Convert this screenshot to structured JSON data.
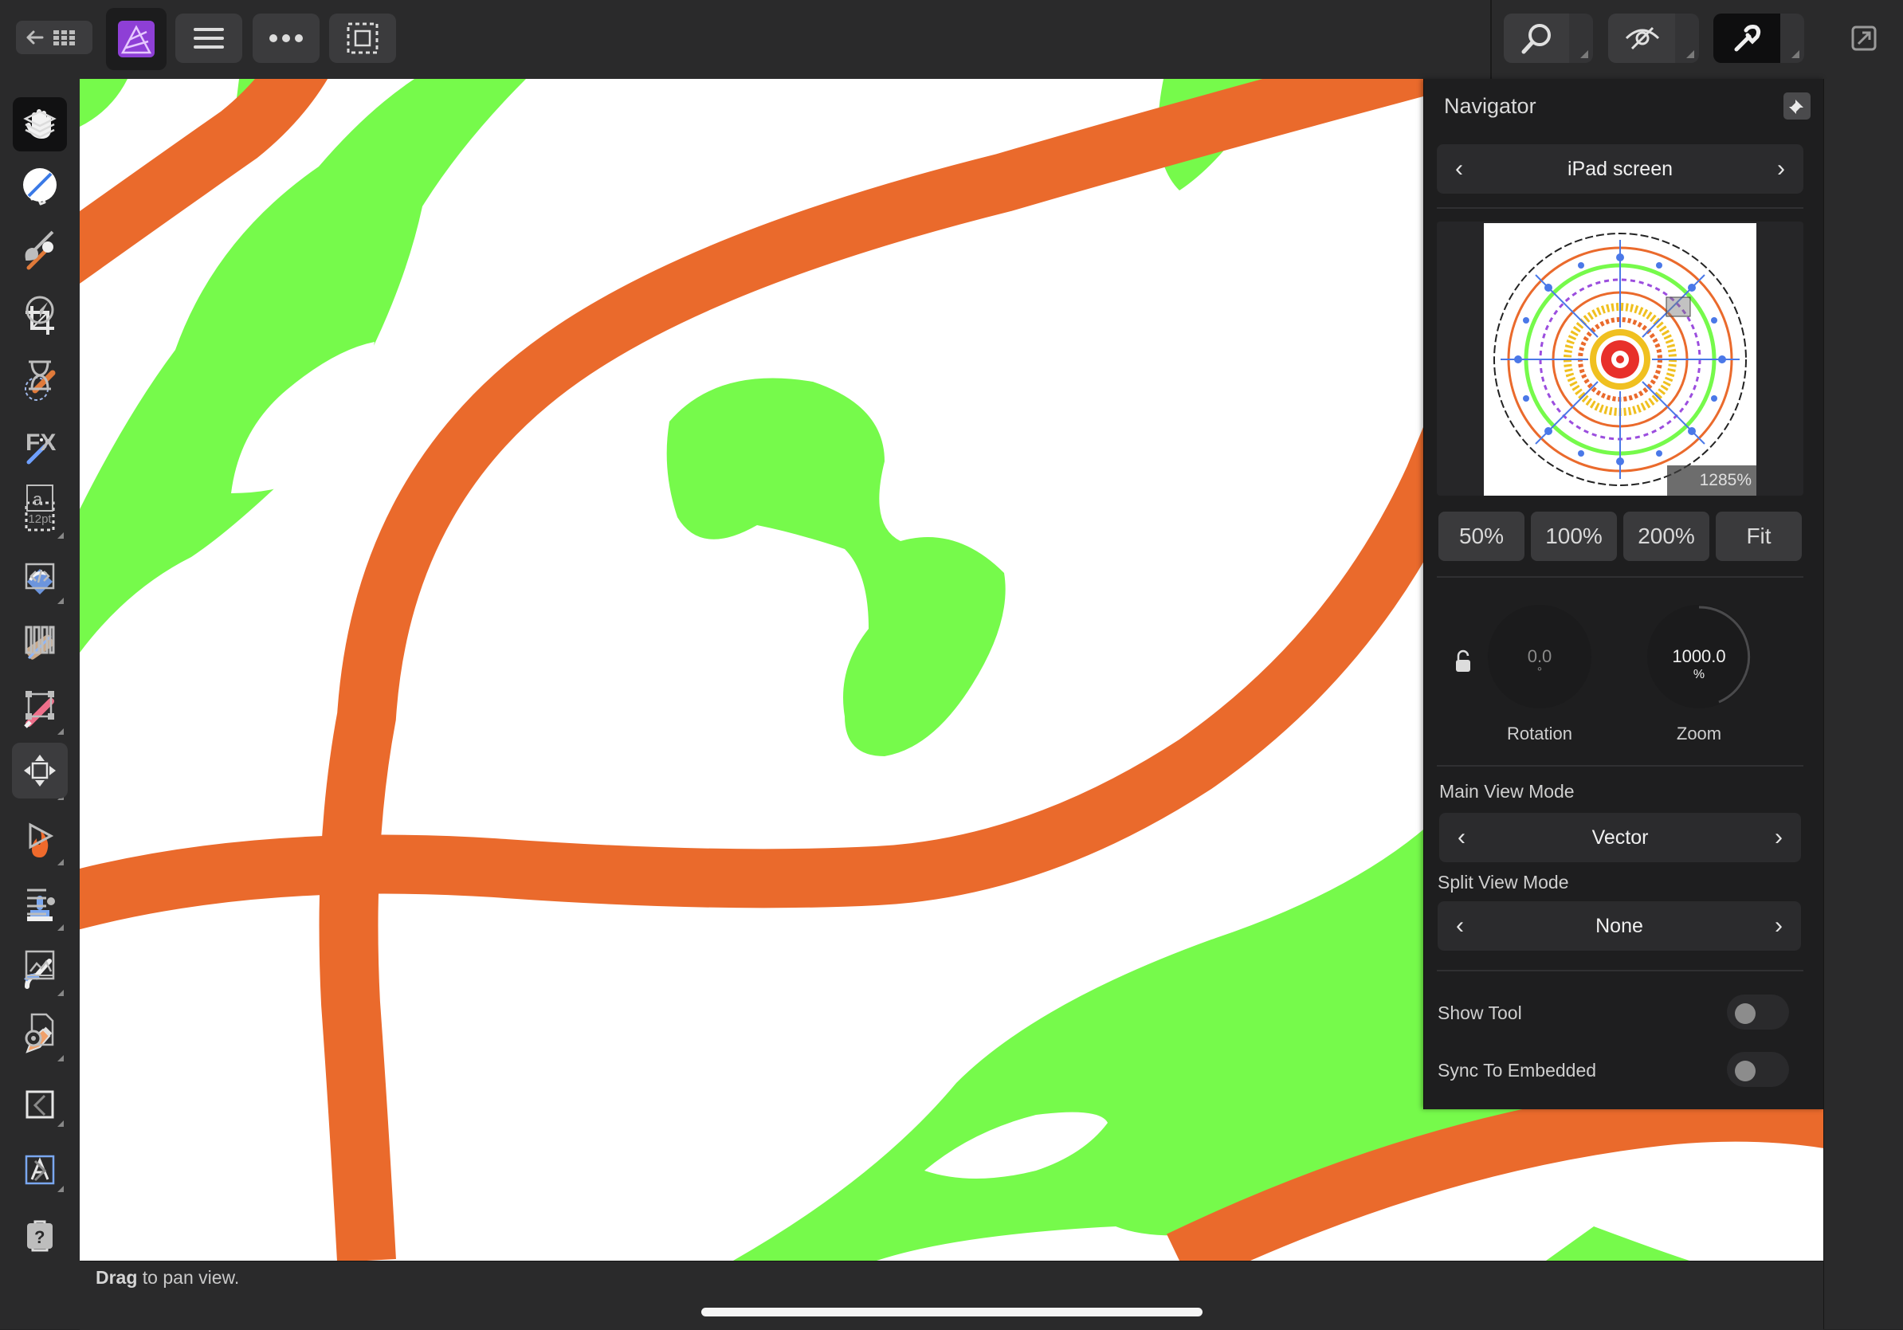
{
  "topbar": {
    "back_icon": "back-grid-icon",
    "app_icon": "affinity-photo-icon",
    "menu_icon": "hamburger-icon",
    "more_icon": "more-icon",
    "selection_icon": "selection-marquee-icon",
    "zoom_icon": "zoom-icon",
    "view_icon": "view-eye-icon",
    "assist_icon": "assistant-icon",
    "fullscreen_icon": "fullscreen-icon"
  },
  "left_tools": [
    "hand-icon",
    "move-pointer-icon",
    "color-picker-icon",
    "crop-icon",
    "selection-brush-icon",
    "flood-select-icon",
    "marquee-icon",
    "flood-fill-icon",
    "gradient-icon",
    "paint-brush-icon",
    "erase-brush-icon",
    "burn-icon",
    "clone-stamp-icon",
    "healing-brush-icon",
    "pen-icon",
    "rectangle-icon",
    "artistic-text-icon",
    "delete-icon"
  ],
  "right_studio": [
    "layers-icon",
    "color-icon",
    "brushes-icon",
    "adjustments-icon",
    "history-icon",
    "fx-icon",
    "text-styles-icon",
    "macro-icon",
    "channels-icon",
    "transform-icon",
    "navigator-icon",
    "play-icon",
    "stock-icon",
    "library-icon",
    "document-settings-icon",
    "collapse-left-icon",
    "expand-right-icon",
    "help-icon"
  ],
  "text_styles_label": "12pt",
  "navigator": {
    "title": "Navigator",
    "pin_icon": "pin-icon",
    "view_preset": "iPad screen",
    "thumbnail_zoom": "1285%",
    "zoom_buttons": [
      "50%",
      "100%",
      "200%",
      "Fit"
    ],
    "rotation": {
      "label": "Rotation",
      "value": "0.0",
      "unit": "°"
    },
    "zoom": {
      "label": "Zoom",
      "value": "1000.0",
      "unit": "%"
    },
    "main_view_mode_label": "Main View Mode",
    "main_view_mode": "Vector",
    "split_view_mode_label": "Split View Mode",
    "split_view_mode": "None",
    "show_tool_label": "Show Tool",
    "show_tool": false,
    "sync_label": "Sync To Embedded",
    "sync": false
  },
  "status": {
    "bold": "Drag",
    "rest": " to pan view."
  },
  "colors": {
    "orange": "#EA6A2C",
    "green": "#76FA4B",
    "accent_purple": "#9B4DDE"
  }
}
